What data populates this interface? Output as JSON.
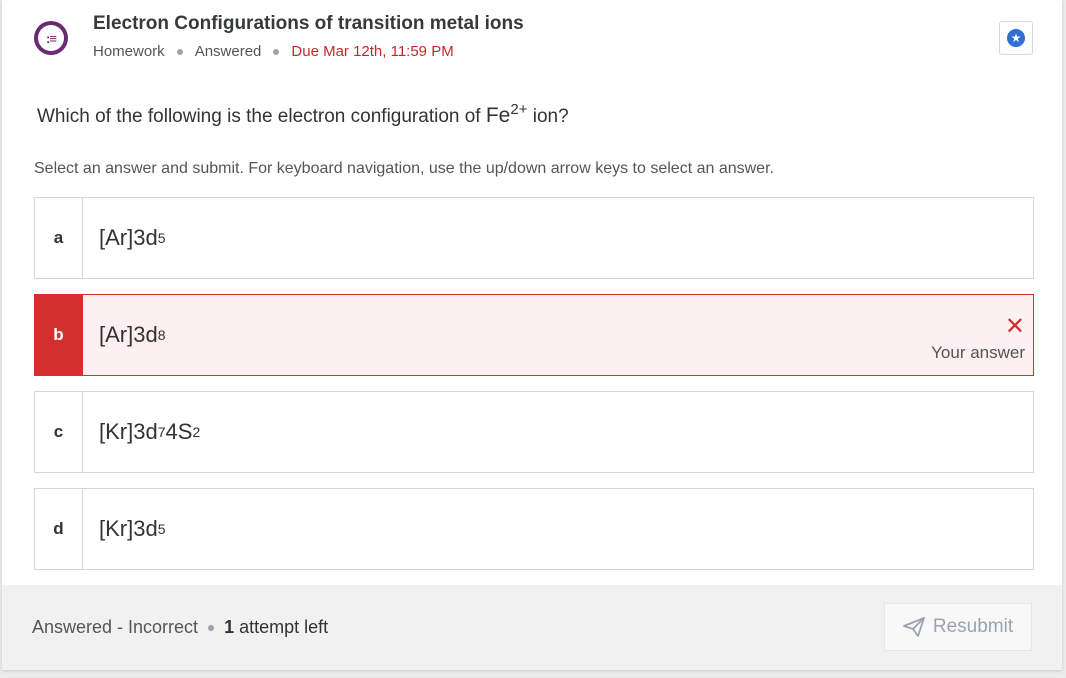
{
  "assignment": {
    "title": "Electron Configurations of transition metal ions",
    "type": "Homework",
    "status": "Answered",
    "due": "Due Mar 12th, 11:59 PM"
  },
  "question": {
    "prefix": "Which of the following is the electron configuration of ",
    "formula_base": "Fe",
    "formula_sup": "2+",
    "suffix": " ion?"
  },
  "instructions": "Select an answer and submit. For keyboard navigation, use the up/down arrow keys to select an answer.",
  "options": [
    {
      "letter": "a",
      "core": "[Ar]",
      "orbital1": "3d",
      "sup1": "5",
      "orbital2": "",
      "sup2": ""
    },
    {
      "letter": "b",
      "core": "[Ar]",
      "orbital1": "3d",
      "sup1": "8",
      "orbital2": "",
      "sup2": "",
      "selected": true,
      "result_label": "Your answer"
    },
    {
      "letter": "c",
      "core": "[Kr]",
      "orbital1": "3d",
      "sup1": "7",
      "orbital2": "4S",
      "sup2": "2"
    },
    {
      "letter": "d",
      "core": "[Kr]",
      "orbital1": "3d",
      "sup1": "5",
      "orbital2": "",
      "sup2": ""
    }
  ],
  "footer": {
    "result": "Answered - Incorrect",
    "attempts_count": "1",
    "attempts_text": " attempt left",
    "resubmit_label": "Resubmit"
  },
  "icons": {
    "header": "question-list-icon",
    "bookmark": "star-icon",
    "incorrect": "x-icon",
    "resubmit": "send-icon"
  },
  "colors": {
    "incorrect": "#d32f2f",
    "incorrect_bg": "#fdf0f0",
    "accent_purple": "#6b2a73",
    "bookmark_blue": "#2f6fd6"
  }
}
